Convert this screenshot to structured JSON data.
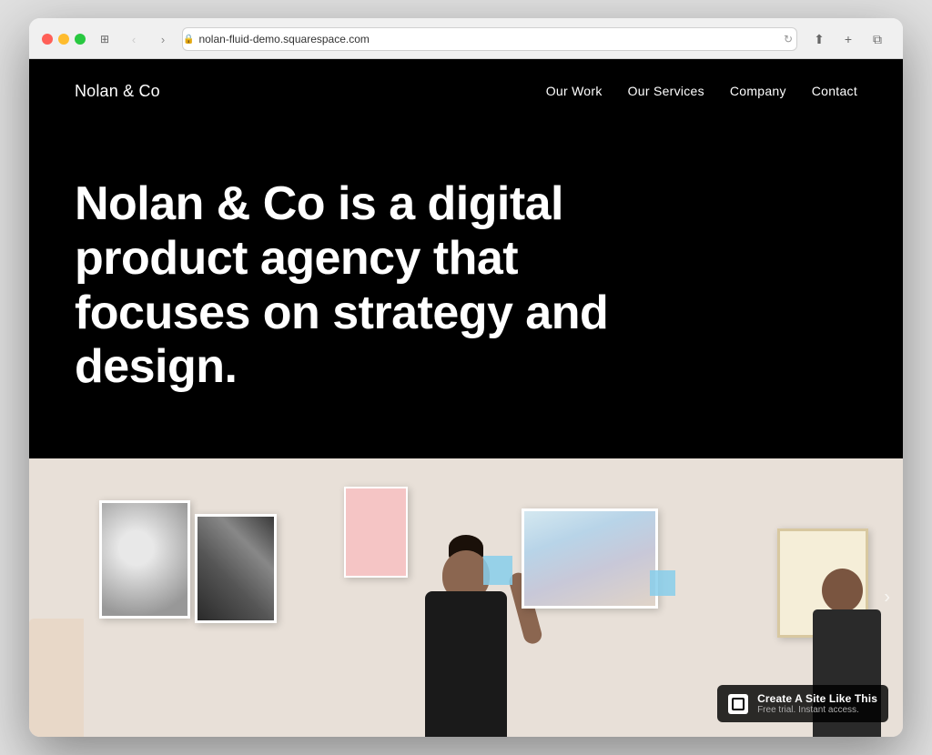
{
  "browser": {
    "url": "nolan-fluid-demo.squarespace.com",
    "traffic_lights": [
      "red",
      "yellow",
      "green"
    ]
  },
  "site": {
    "logo": "Nolan & Co",
    "nav": {
      "items": [
        {
          "label": "Our Work",
          "id": "our-work"
        },
        {
          "label": "Our Services",
          "id": "our-services"
        },
        {
          "label": "Company",
          "id": "company"
        },
        {
          "label": "Contact",
          "id": "contact"
        }
      ]
    },
    "hero": {
      "title": "Nolan & Co is a digital product agency that focuses on strategy and design."
    },
    "badge": {
      "main_text": "Create A Site Like This",
      "sub_text": "Free trial. Instant access."
    }
  }
}
